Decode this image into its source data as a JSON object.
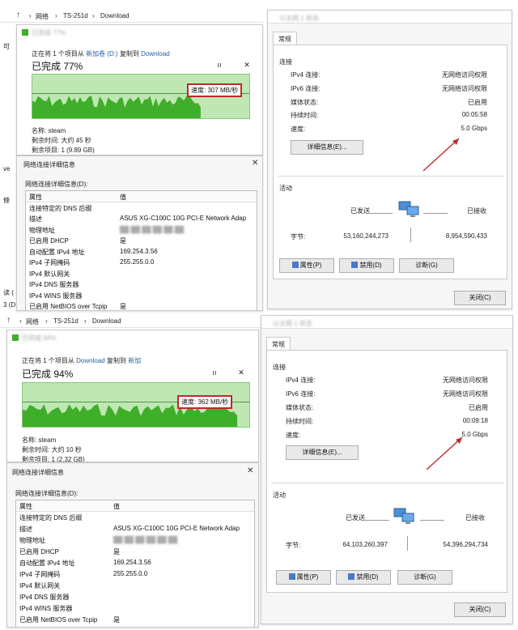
{
  "top": {
    "breadcrumb": {
      "part1": "网络",
      "part2": "TS-251d",
      "part3": "Download",
      "sep": "›"
    },
    "copy_dialog": {
      "title": "已完成 77%",
      "line_prefix": "正在将 1 个项目从",
      "source": "新加卷 (D:)",
      "copy_to": "复制到",
      "dest": "Download",
      "percent_title": "已完成 77%",
      "speed": "速度: 307 MB/秒",
      "name_label": "名称: steam",
      "time_label": "剩余时间: 大约 45 秒",
      "items_label": "剩余项目: 1 (9.89 GB)",
      "pause_symbol": "ıı",
      "close_symbol": "✕",
      "chart": {
        "type": "area",
        "fill_fraction": 0.77
      }
    },
    "details": {
      "title": "网络连接详细信息",
      "subtitle": "网络连接详细信息(D):",
      "header_prop": "属性",
      "header_val": "值",
      "rows": [
        {
          "prop": "连接特定的 DNS 后缀",
          "val": ""
        },
        {
          "prop": "描述",
          "val": "ASUS XG-C100C 10G PCI-E Network Adap"
        },
        {
          "prop": "物理地址",
          "val": "██ ██ ██ ██ ██ ██"
        },
        {
          "prop": "已启用 DHCP",
          "val": "是"
        },
        {
          "prop": "自动配置 IPv4 地址",
          "val": "169.254.3.56"
        },
        {
          "prop": "IPv4 子网掩码",
          "val": "255.255.0.0"
        },
        {
          "prop": "IPv4 默认网关",
          "val": ""
        },
        {
          "prop": "IPv4 DNS 服务器",
          "val": ""
        },
        {
          "prop": "IPv4 WINS 服务器",
          "val": ""
        },
        {
          "prop": "已启用 NetBIOS over Tcpip",
          "val": "是"
        }
      ]
    },
    "status": {
      "title": "以太网 1 状态",
      "tab": "常规",
      "connection_label": "连接",
      "ipv4_label": "IPv4 连接:",
      "ipv4_val": "无网络访问权限",
      "ipv6_label": "IPv6 连接:",
      "ipv6_val": "无网络访问权限",
      "media_label": "媒体状态:",
      "media_val": "已启用",
      "duration_label": "持续时间:",
      "duration_val": "00:05:58",
      "speed_label": "速度:",
      "speed_val": "5.0 Gbps",
      "details_btn": "详细信息(E)...",
      "activity_label": "活动",
      "sent_label": "已发送",
      "recv_label": "已接收",
      "bytes_label": "字节:",
      "bytes_sent": "53,160,244,273",
      "bytes_recv": "8,954,590,433",
      "props_btn": "属性(P)",
      "disable_btn": "禁用(D)",
      "diag_btn": "诊断(G)",
      "close_btn": "关闭(C)"
    },
    "left_fragments": [
      "可",
      "ve",
      "條",
      "读 (",
      "3 (D:"
    ]
  },
  "bottom": {
    "breadcrumb": {
      "part1": "网络",
      "part2": "TS-251d",
      "part3": "Download",
      "sep": "›"
    },
    "copy_dialog": {
      "title": "已完成 94%",
      "line_prefix": "正在将 1 个项目从",
      "source": "Download",
      "copy_to": "复制到",
      "dest": "新加",
      "percent_title": "已完成 94%",
      "speed": "速度: 362 MB/秒",
      "name_label": "名称: steam",
      "time_label": "剩余时间: 大约 10 秒",
      "items_label": "剩余项目: 1 (2.32 GB)",
      "pause_symbol": "ıı",
      "close_symbol": "✕",
      "chart": {
        "type": "area",
        "fill_fraction": 0.94
      }
    },
    "details": {
      "title": "网络连接详细信息",
      "subtitle": "网络连接详细信息(D):",
      "header_prop": "属性",
      "header_val": "值",
      "rows": [
        {
          "prop": "连接特定的 DNS 后缀",
          "val": ""
        },
        {
          "prop": "描述",
          "val": "ASUS XG-C100C 10G PCI-E Network Adap"
        },
        {
          "prop": "物理地址",
          "val": "██ ██ ██ ██ ██ ██"
        },
        {
          "prop": "已启用 DHCP",
          "val": "是"
        },
        {
          "prop": "自动配置 IPv4 地址",
          "val": "169.254.3.56"
        },
        {
          "prop": "IPv4 子网掩码",
          "val": "255.255.0.0"
        },
        {
          "prop": "IPv4 默认网关",
          "val": ""
        },
        {
          "prop": "IPv4 DNS 服务器",
          "val": ""
        },
        {
          "prop": "IPv4 WINS 服务器",
          "val": ""
        },
        {
          "prop": "已启用 NetBIOS over Tcpip",
          "val": "是"
        }
      ]
    },
    "status": {
      "title": "以太网 1 状态",
      "tab": "常规",
      "connection_label": "连接",
      "ipv4_label": "IPv4 连接:",
      "ipv4_val": "无网络访问权限",
      "ipv6_label": "IPv6 连接:",
      "ipv6_val": "无网络访问权限",
      "media_label": "媒体状态:",
      "media_val": "已启用",
      "duration_label": "持续时间:",
      "duration_val": "00:09:18",
      "speed_label": "速度:",
      "speed_val": "5.0 Gbps",
      "details_btn": "详细信息(E)...",
      "activity_label": "活动",
      "sent_label": "已发送",
      "recv_label": "已接收",
      "bytes_label": "字节:",
      "bytes_sent": "64,103,260,397",
      "bytes_recv": "54,396,294,734",
      "props_btn": "属性(P)",
      "disable_btn": "禁用(D)",
      "diag_btn": "诊断(G)",
      "close_btn": "关闭(C)"
    }
  },
  "colors": {
    "chart_fill": "#3fae2a",
    "chart_bg": "#bfe7b4",
    "highlight": "#c0282a",
    "link": "#2563a8"
  }
}
